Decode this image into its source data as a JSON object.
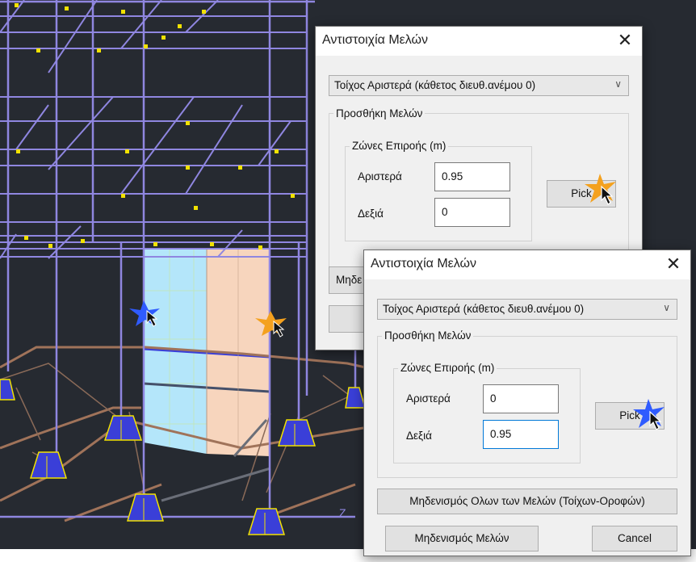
{
  "dialog_back": {
    "title": "Αντιστοιχία Μελών",
    "close_glyph": "✕",
    "wall_select": "Τοίχος Αριστερά (κάθετος διευθ.ανέμου 0)",
    "group_add": "Προσθήκη Μελών",
    "group_zones": "Ζώνες Επιροής (m)",
    "left_label": "Αριστερά",
    "left_value": "0.95",
    "right_label": "Δεξιά",
    "right_value": "0",
    "pick_label": "Pick",
    "zero_label_partial": "Μηδε"
  },
  "dialog_front": {
    "title": "Αντιστοιχία Μελών",
    "close_glyph": "✕",
    "wall_select": "Τοίχος Αριστερά (κάθετος διευθ.ανέμου 0)",
    "group_add": "Προσθήκη Μελών",
    "group_zones": "Ζώνες Επιροής (m)",
    "left_label": "Αριστερά",
    "left_value": "0",
    "right_label": "Δεξιά",
    "right_value": "0.95",
    "pick_label": "Pick",
    "zero_all_button": "Μηδενισμός Ολων των Μελών (Τοίχων-Οροφών)",
    "zero_button": "Μηδενισμός Μελών",
    "cancel_button": "Cancel"
  },
  "viewport": {
    "axis_label": "Z",
    "colors": {
      "background": "#262a31",
      "frame": "#8f86e0",
      "node": "#f2e200",
      "wall_left": "#b4e6fa",
      "wall_right": "#f7d5bd",
      "footing": "#3a3fd8",
      "beam": "#a0735a"
    }
  }
}
